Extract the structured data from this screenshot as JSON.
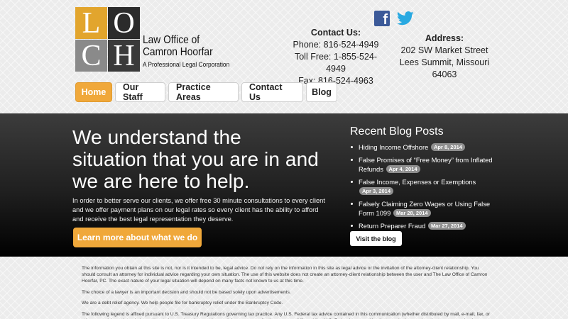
{
  "logo": {
    "letters": [
      "L",
      "O",
      "C",
      "H"
    ],
    "name_line1": "Law Office of",
    "name_line2": "Camron Hoorfar",
    "tagline": "A Professional Legal Corporation",
    "colors": {
      "orange": "#e2a52d",
      "dark": "#2b2b2b",
      "gray": "#8a8a8a"
    }
  },
  "social": {
    "facebook_icon": "facebook-icon",
    "twitter_icon": "twitter-icon",
    "facebook_glyph": "f"
  },
  "contact": {
    "heading": "Contact Us:",
    "phone": "Phone: 816-524-4949",
    "toll_free": "Toll Free: 1-855-524-4949",
    "fax": "Fax: 816-524-4963"
  },
  "address": {
    "heading": "Address:",
    "line1": "202 SW Market Street",
    "line2": "Lees Summit, Missouri 64063"
  },
  "nav": {
    "items": [
      {
        "label": "Home",
        "active": true
      },
      {
        "label": "Our Staff",
        "active": false
      },
      {
        "label": "Practice Areas",
        "active": false
      },
      {
        "label": "Contact Us",
        "active": false
      },
      {
        "label": "Blog",
        "active": false
      }
    ],
    "accent": "#f0a83a"
  },
  "hero": {
    "title": "We understand the situation that you are in and we are here to help.",
    "body": "In order to better serve our clients, we offer free 30 minute consultations to every client and we offer payment plans on our legal rates so every client has the ability to afford and receive the best legal representation they deserve.",
    "cta": "Learn more about what we do"
  },
  "blog": {
    "title": "Recent Blog Posts",
    "posts": [
      {
        "title": "Hiding Income Offshore",
        "date": "Apr 8, 2014"
      },
      {
        "title": "False Promises of “Free Money” from Inflated Refunds",
        "date": "Apr 4, 2014"
      },
      {
        "title": "False Income, Expenses or Exemptions",
        "date": "Apr 3, 2014"
      },
      {
        "title": "Falsely Claiming Zero Wages or Using False Form 1099",
        "date": "Mar 28, 2014"
      },
      {
        "title": "Return Preparer Fraud",
        "date": "Mar 27, 2014"
      }
    ],
    "visit_label": "Visit the blog"
  },
  "disclaimer": {
    "p1": "The information you obtain at this site is not, nor is it intended to be, legal advice. Do not rely on the information in this site as legal advice or the invitation of the attorney-client relationship. You should consult an attorney for individual advice regarding your own situation. The use of this website does not create an attorney-client relationship between the user and The Law Office of Camron Hoorfar, PC. The exact nature of your legal situation will depend on many facts not known to us at this time.",
    "p2": "The choice of a lawyer is an important decision and should not be based solely upon advertisements.",
    "p3": "We are a debt relief agency. We help people file for bankruptcy relief under the Bankruptcy Code.",
    "p4": "The following legend is affixed pursuant to U.S. Treasury Regulations governing tax practice. Any U.S. Federal tax advice contained in this communication (whether distributed by mail, e-mail, fax, or other means) is not intended or written to be used, and cannot be used, by any person for the purpose of (i) avoiding U.S. Federal tax penalties that may be imposed on the taxpayer under the Internal Revenue"
  }
}
